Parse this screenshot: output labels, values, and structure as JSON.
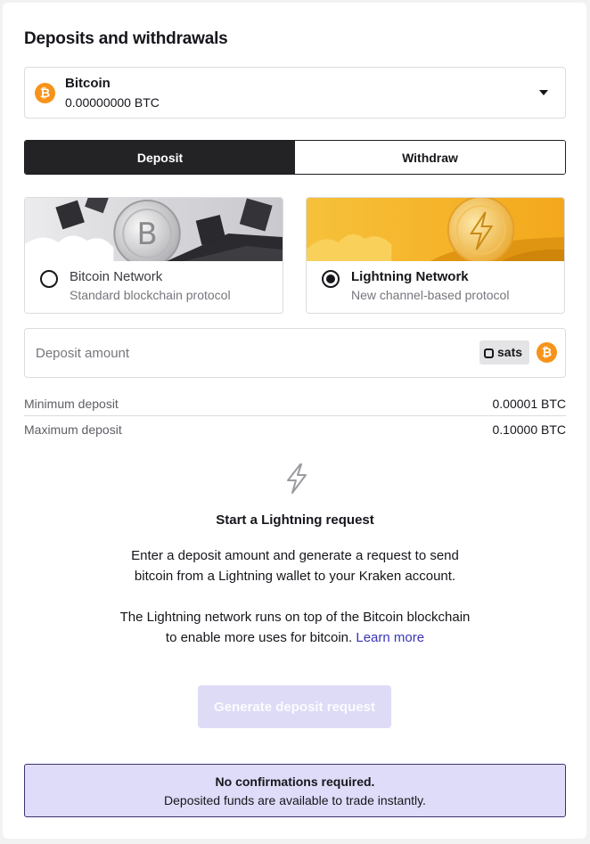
{
  "title": "Deposits and withdrawals",
  "asset_select": {
    "name": "Bitcoin",
    "balance": "0.00000000 BTC",
    "icon": "bitcoin-coin-icon",
    "coin_symbol": "₿"
  },
  "tabs": [
    {
      "label": "Deposit",
      "active": true
    },
    {
      "label": "Withdraw",
      "active": false
    }
  ],
  "networks": [
    {
      "name": "Bitcoin Network",
      "description": "Standard blockchain protocol",
      "selected": false
    },
    {
      "name": "Lightning Network",
      "description": "New channel-based protocol",
      "selected": true
    }
  ],
  "amount_field": {
    "placeholder": "Deposit amount",
    "value": "",
    "unit_label": "sats"
  },
  "limits": {
    "min_label": "Minimum deposit",
    "min_value": "0.00001 BTC",
    "max_label": "Maximum deposit",
    "max_value": "0.10000 BTC"
  },
  "request": {
    "icon": "lightning-bolt-icon",
    "title": "Start a Lightning request",
    "para1_line1": "Enter a deposit amount and generate a request to send",
    "para1_line2": "bitcoin from a Lightning wallet to your Kraken account.",
    "para2_line1": "The Lightning network runs on top of the Bitcoin blockchain",
    "para2_line2": "to enable more uses for bitcoin.",
    "learn_more": "Learn more",
    "button": "Generate deposit request"
  },
  "notice": {
    "title": "No confirmations required.",
    "body": "Deposited funds are available to trade instantly."
  },
  "colors": {
    "bitcoin_orange": "#f7931a",
    "dark": "#232326",
    "link": "#3a34b8",
    "notice_bg": "#dedcf8",
    "disabled_button": "#dddbf6"
  }
}
